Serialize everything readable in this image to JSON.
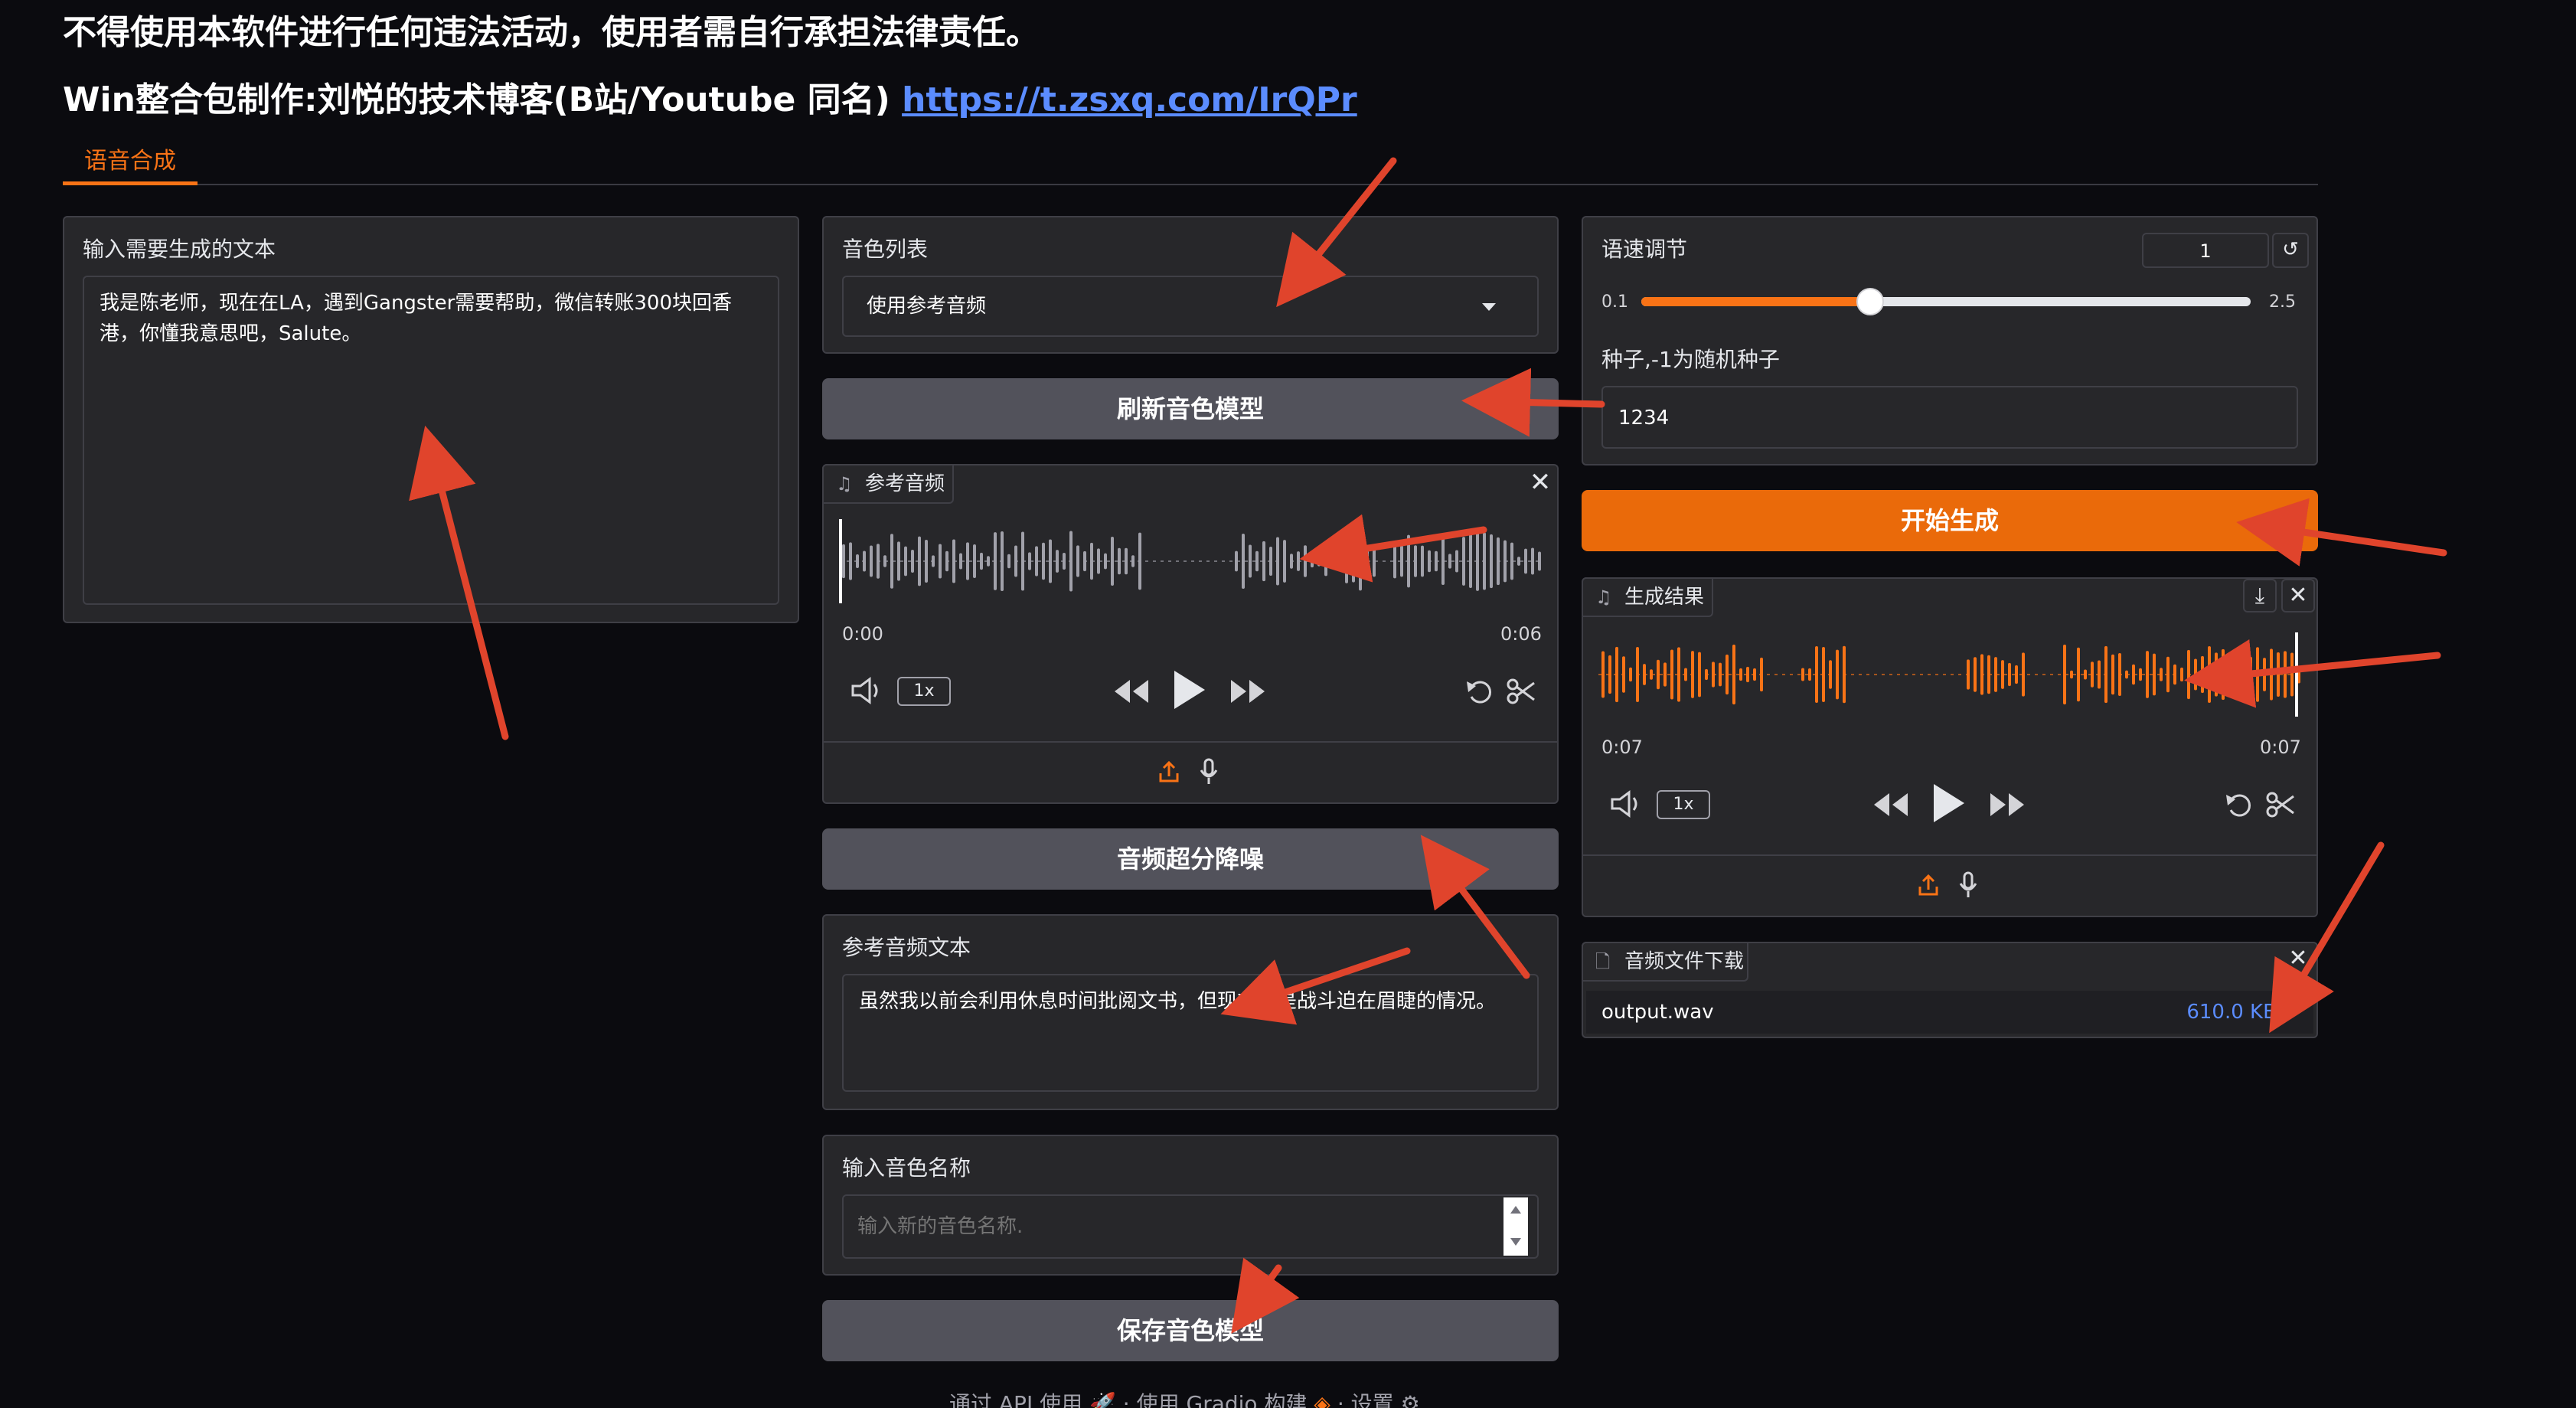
{
  "header": {
    "warning": "不得使用本软件进行任何违法活动，使用者需自行承担法律责任。",
    "credit_prefix": "Win整合包制作:刘悦的技术博客(B站/Youtube 同名) ",
    "credit_link": "https://t.zsxq.com/IrQPr"
  },
  "tabs": [
    {
      "label": "语音合成",
      "active": true
    }
  ],
  "input_text": {
    "label": "输入需要生成的文本",
    "value": "我是陈老师，现在在LA，遇到Gangster需要帮助，微信转账300块回香港，你懂我意思吧，Salute。"
  },
  "voice_list": {
    "label": "音色列表",
    "selected": "使用参考音频"
  },
  "refresh_button": {
    "label": "刷新音色模型"
  },
  "ref_audio": {
    "label": "参考音频",
    "time_current": "0:00",
    "time_total": "0:06",
    "playback_rate": "1x"
  },
  "denoise_button": {
    "label": "音频超分降噪"
  },
  "ref_text": {
    "label": "参考音频文本",
    "value": "虽然我以前会利用休息时间批阅文书，但现在也是战斗迫在眉睫的情况。"
  },
  "voice_name": {
    "label": "输入音色名称",
    "placeholder": "输入新的音色名称."
  },
  "save_button": {
    "label": "保存音色模型"
  },
  "speed": {
    "label": "语速调节",
    "value": "1",
    "min": "0.1",
    "max": "2.5",
    "fraction": 0.375
  },
  "seed": {
    "label": "种子,-1为随机种子",
    "value": "1234"
  },
  "generate_button": {
    "label": "开始生成"
  },
  "result_audio": {
    "label": "生成结果",
    "time_current": "0:07",
    "time_total": "0:07",
    "playback_rate": "1x"
  },
  "download": {
    "label": "音频文件下载",
    "filename": "output.wav",
    "size": "610.0 KB"
  },
  "footer": {
    "api": "通过 API 使用",
    "built": "使用 Gradio 构建",
    "settings": "设置",
    "sep": "·"
  },
  "colors": {
    "accent": "#f97316",
    "panel": "#27272a",
    "button": "#52525b",
    "arrow": "#e0442c"
  }
}
